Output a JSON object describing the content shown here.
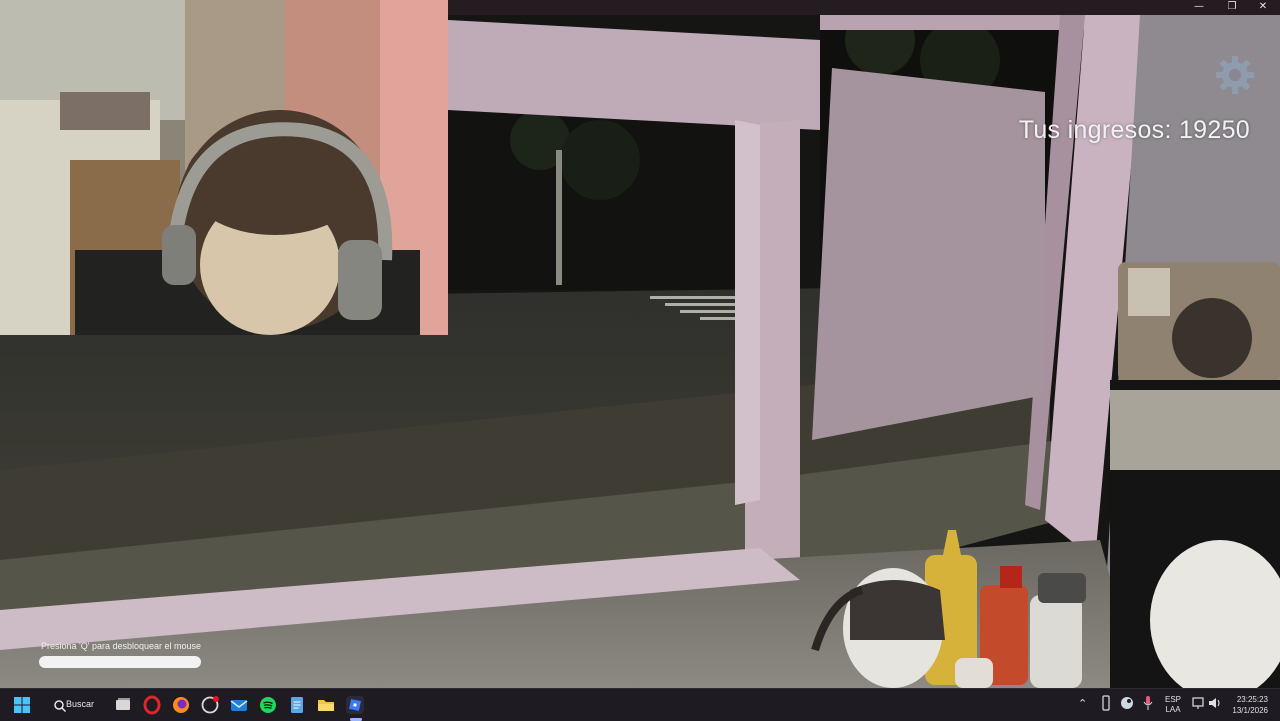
{
  "window": {
    "minimize_glyph": "—",
    "maximize_glyph": "❐",
    "close_glyph": "✕"
  },
  "game": {
    "income_label": "Tus ingresos: 19250",
    "settings_icon": "gear-icon",
    "unlock_hint": "Presiona 'Q' para desbloquear el mouse"
  },
  "taskbar": {
    "search_label": "Buscar",
    "pinned_apps": [
      "task-view-icon",
      "opera-icon",
      "firefox-icon",
      "app-icon",
      "mail-icon",
      "spotify-icon",
      "notepad-icon",
      "file-explorer-icon",
      "roblox-icon"
    ],
    "language_line1": "ESP",
    "language_line2": "LAA",
    "time": "23:25:23",
    "date": "13/1/2026"
  },
  "colors": {
    "taskbar_bg": "#1e1b22",
    "income_text": "#f2f2f2"
  }
}
